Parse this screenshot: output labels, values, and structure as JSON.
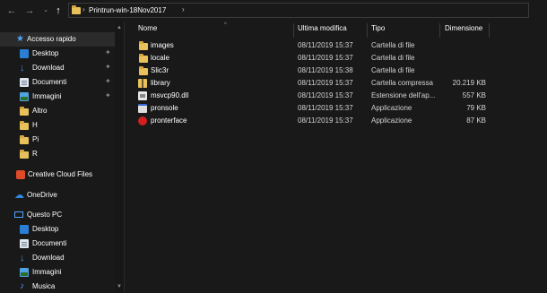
{
  "address": {
    "crumbs": [
      "Printrun-win-18Nov2017"
    ]
  },
  "sidebar": {
    "items": [
      {
        "label": "Accesso rapido",
        "icon": "star-icon"
      },
      {
        "label": "Desktop",
        "icon": "desktop-icon",
        "pinned": true
      },
      {
        "label": "Download",
        "icon": "download-icon",
        "pinned": true
      },
      {
        "label": "Documenti",
        "icon": "documents-icon",
        "pinned": true
      },
      {
        "label": "Immagini",
        "icon": "pictures-icon",
        "pinned": true
      },
      {
        "label": "Altro",
        "icon": "folder-icon"
      },
      {
        "label": "H",
        "icon": "folder-icon"
      },
      {
        "label": "Pi",
        "icon": "folder-icon"
      },
      {
        "label": "R",
        "icon": "folder-icon"
      },
      {
        "label": "Creative Cloud Files",
        "icon": "creative-cloud-icon"
      },
      {
        "label": "OneDrive",
        "icon": "onedrive-icon"
      },
      {
        "label": "Questo PC",
        "icon": "this-pc-icon"
      },
      {
        "label": "Desktop",
        "icon": "desktop-icon"
      },
      {
        "label": "Documenti",
        "icon": "documents-icon"
      },
      {
        "label": "Download",
        "icon": "download-icon"
      },
      {
        "label": "Immagini",
        "icon": "pictures-icon"
      },
      {
        "label": "Musica",
        "icon": "music-icon"
      }
    ]
  },
  "columns": {
    "name": "Nome",
    "date": "Ultima modifica",
    "type": "Tipo",
    "size": "Dimensione"
  },
  "files": [
    {
      "name": "images",
      "date": "08/11/2019 15:37",
      "type": "Cartella di file",
      "size": "",
      "icon": "folder-icon"
    },
    {
      "name": "locale",
      "date": "08/11/2019 15:37",
      "type": "Cartella di file",
      "size": "",
      "icon": "folder-icon"
    },
    {
      "name": "Slic3r",
      "date": "08/11/2019 15:38",
      "type": "Cartella di file",
      "size": "",
      "icon": "folder-icon"
    },
    {
      "name": "library",
      "date": "08/11/2019 15:37",
      "type": "Cartella compressa",
      "size": "20.219 KB",
      "icon": "zip-folder-icon"
    },
    {
      "name": "msvcp90.dll",
      "date": "08/11/2019 15:37",
      "type": "Estensione dell'ap...",
      "size": "557 KB",
      "icon": "dll-file-icon"
    },
    {
      "name": "pronsole",
      "date": "08/11/2019 15:37",
      "type": "Applicazione",
      "size": "79 KB",
      "icon": "application-icon"
    },
    {
      "name": "pronterface",
      "date": "08/11/2019 15:37",
      "type": "Applicazione",
      "size": "87 KB",
      "icon": "pronterface-app-icon"
    }
  ]
}
